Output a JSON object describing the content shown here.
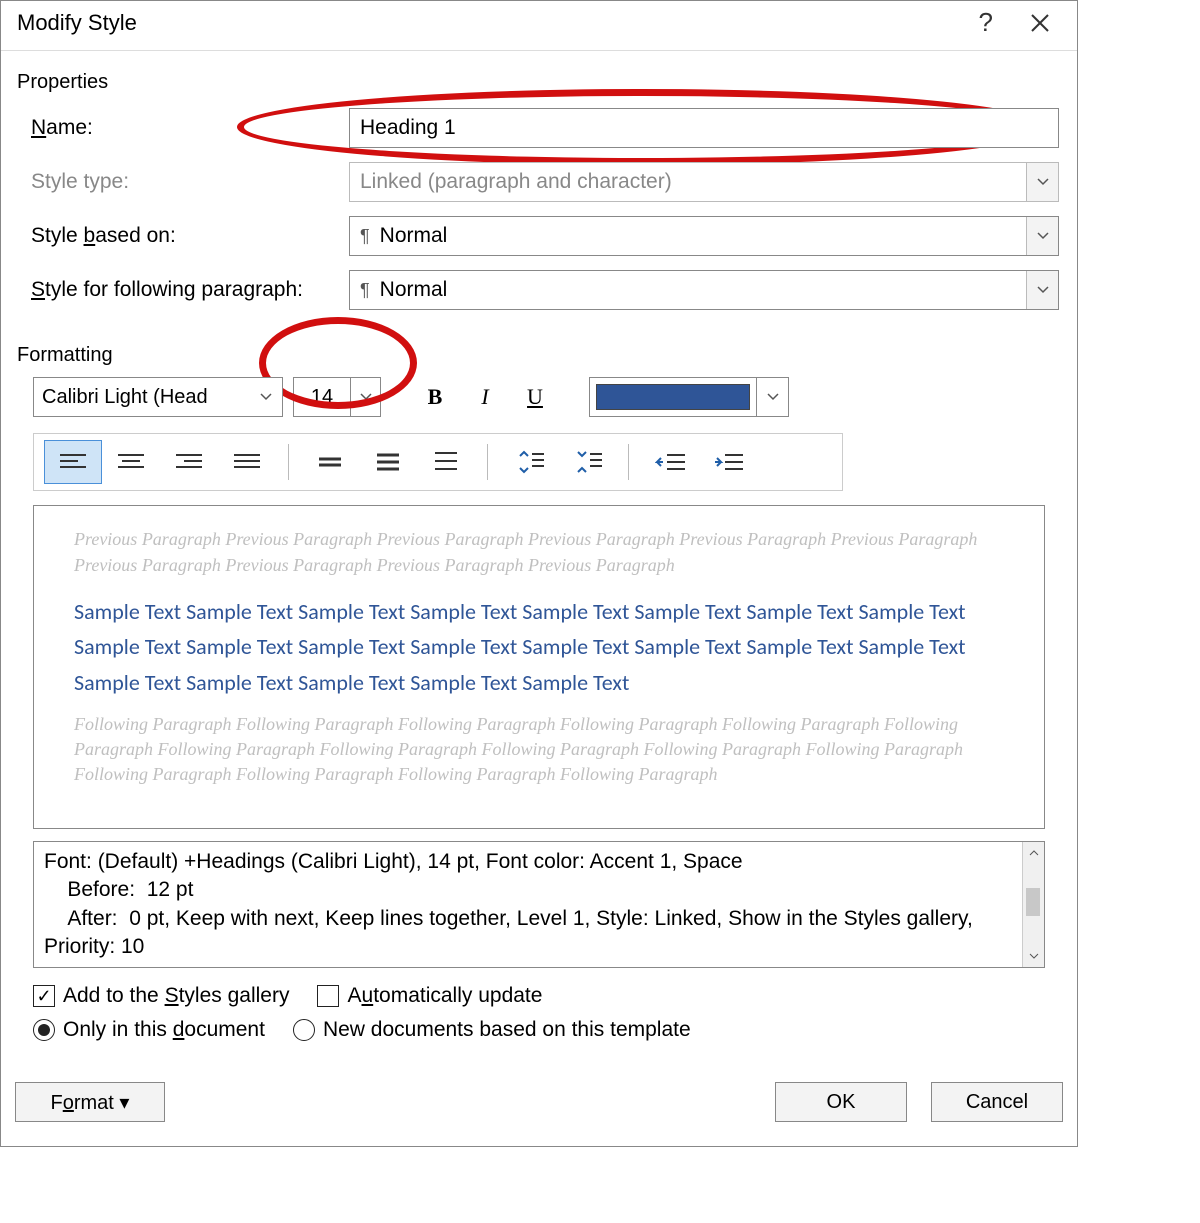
{
  "titlebar": {
    "title": "Modify Style",
    "help": "?",
    "close": "×"
  },
  "sections": {
    "properties": "Properties",
    "formatting": "Formatting"
  },
  "properties": {
    "name_label": "Name:",
    "name_label_u": "N",
    "name_value": "Heading 1",
    "type_label": "Style type:",
    "type_value": "Linked (paragraph and character)",
    "based_label_pre": "Style ",
    "based_label_u": "b",
    "based_label_post": "ased on:",
    "based_value": "Normal",
    "following_label_pre": "",
    "following_label_u": "S",
    "following_label_post": "tyle for following paragraph:",
    "following_value": "Normal",
    "pilcrow": "¶"
  },
  "formatting": {
    "font_name": "Calibri Light (Head",
    "font_size": "14",
    "bold": "B",
    "italic": "I",
    "underline": "U",
    "font_color": "#2F5597"
  },
  "preview": {
    "previous": "Previous Paragraph Previous Paragraph Previous Paragraph Previous Paragraph Previous Paragraph Previous Paragraph Previous Paragraph Previous Paragraph Previous Paragraph Previous Paragraph",
    "sample": "Sample Text Sample Text Sample Text Sample Text Sample Text Sample Text Sample Text Sample Text Sample Text Sample Text Sample Text Sample Text Sample Text Sample Text Sample Text Sample Text Sample Text Sample Text Sample Text Sample Text Sample Text",
    "following": "Following Paragraph Following Paragraph Following Paragraph Following Paragraph Following Paragraph Following Paragraph Following Paragraph Following Paragraph Following Paragraph Following Paragraph Following Paragraph Following Paragraph Following Paragraph Following Paragraph Following Paragraph"
  },
  "description": {
    "line1": "Font: (Default) +Headings (Calibri Light), 14 pt, Font color: Accent 1, Space",
    "line2": "    Before:  12 pt",
    "line3": "    After:  0 pt, Keep with next, Keep lines together, Level 1, Style: Linked, Show in the Styles gallery, Priority: 10"
  },
  "options": {
    "add_gallery_pre": "Add to the ",
    "add_gallery_u": "S",
    "add_gallery_post": "tyles gallery",
    "auto_update_pre": "A",
    "auto_update_u": "u",
    "auto_update_post": "tomatically update",
    "only_doc_pre": "Only in this ",
    "only_doc_u": "d",
    "only_doc_post": "ocument",
    "new_template": "New documents based on this template",
    "add_gallery_checked": true,
    "auto_update_checked": false,
    "scope_selected": "only_doc"
  },
  "footer": {
    "format_pre": "F",
    "format_u": "o",
    "format_post": "rmat ▾",
    "ok": "OK",
    "cancel": "Cancel"
  }
}
